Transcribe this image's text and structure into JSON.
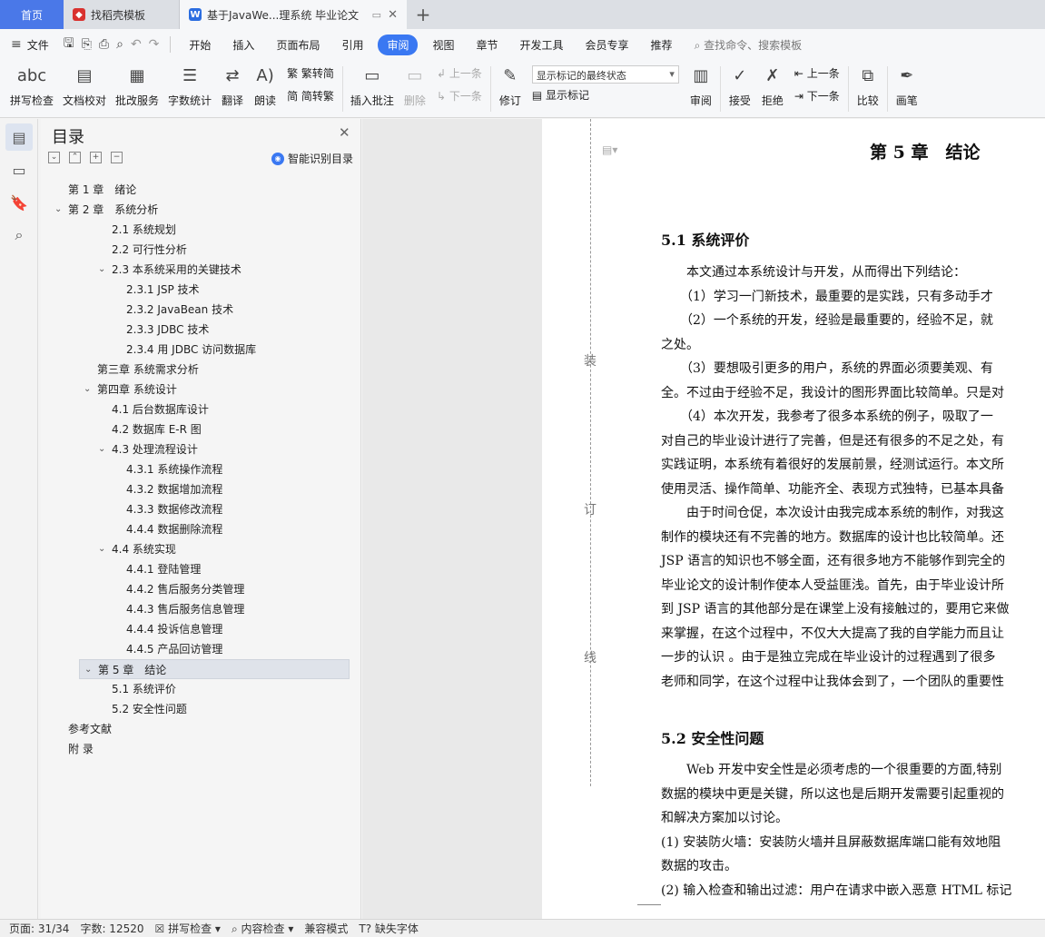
{
  "tabs": {
    "home": "首页",
    "tab1": "找稻壳模板",
    "tab2": "基于JavaWe...理系统 毕业论文"
  },
  "menu": {
    "file": "文件",
    "items": [
      "开始",
      "插入",
      "页面布局",
      "引用",
      "审阅",
      "视图",
      "章节",
      "开发工具",
      "会员专享",
      "推荐"
    ],
    "active": "审阅",
    "search": "查找命令、搜索模板"
  },
  "ribbon": {
    "spell": "拼写检查",
    "proof": "文档校对",
    "batch": "批改服务",
    "count": "字数统计",
    "translate": "翻译",
    "read": "朗读",
    "to_trad": "繁转简",
    "to_simp": "简转繁",
    "insert_comment": "插入批注",
    "delete": "删除",
    "prev": "上一条",
    "next": "下一条",
    "revise": "修订",
    "markup_state": "显示标记的最终状态",
    "show_markup": "显示标记",
    "review": "审阅",
    "accept": "接受",
    "reject": "拒绝",
    "prev2": "上一条",
    "next2": "下一条",
    "compare": "比较",
    "pen": "画笔"
  },
  "toc": {
    "title": "目录",
    "smart": "智能识别目录",
    "items": [
      {
        "text": "第 1 章　绪论",
        "level": 0,
        "chev": false
      },
      {
        "text": "第 2 章　系统分析",
        "level": 0,
        "chev": true
      },
      {
        "text": "2.1  系统规划",
        "level": 2,
        "chev": false
      },
      {
        "text": "2.2  可行性分析",
        "level": 2,
        "chev": false
      },
      {
        "text": "2.3  本系统采用的关键技术",
        "level": 2,
        "chev": true
      },
      {
        "text": "2.3.1 JSP 技术",
        "level": 3,
        "chev": false
      },
      {
        "text": "2.3.2 JavaBean 技术",
        "level": 3,
        "chev": false
      },
      {
        "text": "2.3.3 JDBC 技术",
        "level": 3,
        "chev": false
      },
      {
        "text": "2.3.4  用 JDBC 访问数据库",
        "level": 3,
        "chev": false
      },
      {
        "text": "第三章  系统需求分析",
        "level": 1,
        "chev": false
      },
      {
        "text": "第四章  系统设计",
        "level": 1,
        "chev": true
      },
      {
        "text": "4.1  后台数据库设计",
        "level": 2,
        "chev": false
      },
      {
        "text": "4.2  数据库 E-R 图",
        "level": 2,
        "chev": false
      },
      {
        "text": "4.3  处理流程设计",
        "level": 2,
        "chev": true
      },
      {
        "text": "4.3.1  系统操作流程",
        "level": 3,
        "chev": false
      },
      {
        "text": "4.3.2  数据增加流程",
        "level": 3,
        "chev": false
      },
      {
        "text": "4.3.3  数据修改流程",
        "level": 3,
        "chev": false
      },
      {
        "text": "4.4.4  数据删除流程",
        "level": 3,
        "chev": false
      },
      {
        "text": "4.4  系统实现",
        "level": 2,
        "chev": true
      },
      {
        "text": "4.4.1 登陆管理",
        "level": 3,
        "chev": false
      },
      {
        "text": "4.4.2  售后服务分类管理",
        "level": 3,
        "chev": false
      },
      {
        "text": "4.4.3  售后服务信息管理",
        "level": 3,
        "chev": false
      },
      {
        "text": "4.4.4  投诉信息管理",
        "level": 3,
        "chev": false
      },
      {
        "text": "4.4.5  产品回访管理",
        "level": 3,
        "chev": false
      },
      {
        "text": "第 5 章　结论",
        "level": 1,
        "chev": true,
        "selected": true
      },
      {
        "text": "5.1  系统评价",
        "level": 2,
        "chev": false
      },
      {
        "text": "5.2  安全性问题",
        "level": 2,
        "chev": false
      },
      {
        "text": "参考文献",
        "level": 0,
        "chev": false
      },
      {
        "text": "附  录",
        "level": 0,
        "chev": false
      }
    ]
  },
  "doc": {
    "chapter": "第 5 章　结论",
    "binding": [
      "装",
      "订",
      "线"
    ],
    "h1": "5.1  系统评价",
    "p1": [
      "　　本文通过本系统设计与开发，从而得出下列结论：",
      "　　（1）学习一门新技术，最重要的是实践，只有多动手才",
      "　　（2）一个系统的开发，经验是最重要的，经验不足，就",
      "之处。",
      "　　（3）要想吸引更多的用户，系统的界面必须要美观、有",
      "全。不过由于经验不足，我设计的图形界面比较简单。只是对",
      "　　（4）本次开发，我参考了很多本系统的例子，吸取了一",
      "对自己的毕业设计进行了完善，但是还有很多的不足之处，有",
      "实践证明，本系统有着很好的发展前景，经测试运行。本文所",
      "使用灵活、操作简单、功能齐全、表现方式独特，已基本具备",
      "　　由于时间仓促，本次设计由我完成本系统的制作，对我这",
      "制作的模块还有不完善的地方。数据库的设计也比较简单。还",
      "JSP 语言的知识也不够全面，还有很多地方不能够作到完全的",
      "毕业论文的设计制作使本人受益匪浅。首先，由于毕业设计所",
      "到 JSP 语言的其他部分是在课堂上没有接触过的，要用它来做",
      "来掌握，在这个过程中，不仅大大提高了我的自学能力而且让",
      "一步的认识 。由于是独立完成在毕业设计的过程遇到了很多",
      "老师和同学，在这个过程中让我体会到了，一个团队的重要性"
    ],
    "h2": "5.2  安全性问题",
    "p2": [
      "　　Web 开发中安全性是必须考虑的一个很重要的方面,特别",
      "数据的模块中更是关键，所以这也是后期开发需要引起重视的",
      "和解决方案加以讨论。",
      "(1)  安装防火墙：安装防火墙并且屏蔽数据库端口能有效地阻",
      "数据的攻击。",
      "(2)  输入检查和输出过滤：用户在请求中嵌入恶意 HTML 标记"
    ]
  },
  "status": {
    "page": "页面: 31/34",
    "words": "字数: 12520",
    "spell": "拼写检查",
    "content": "内容检查",
    "compat": "兼容模式",
    "font": "缺失字体"
  }
}
